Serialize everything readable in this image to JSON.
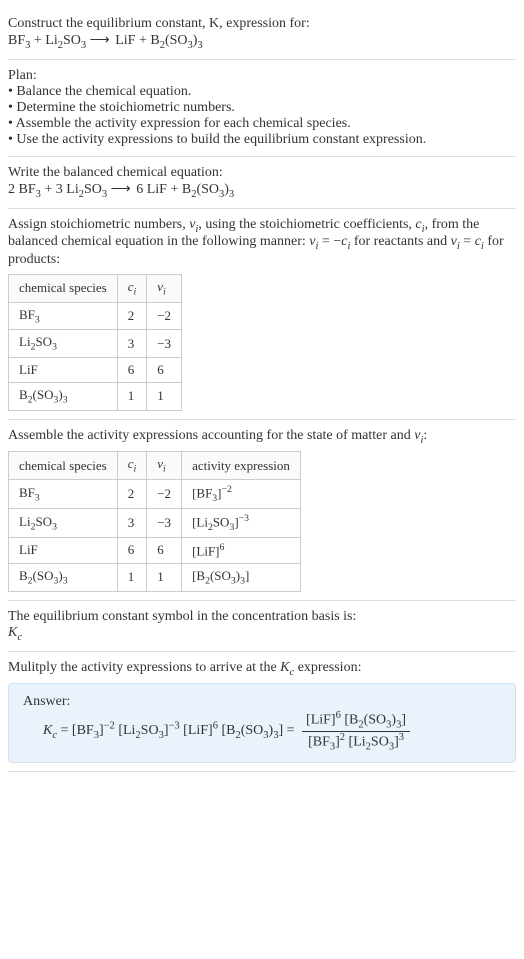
{
  "intro": {
    "line1": "Construct the equilibrium constant, K, expression for:",
    "eq1_lhs1": "BF",
    "eq1_lhs1_sub": "3",
    "eq1_plus1": " + ",
    "eq1_lhs2": "Li",
    "eq1_lhs2_sub": "2",
    "eq1_lhs2b": "SO",
    "eq1_lhs2b_sub": "3",
    "arrow": " ⟶ ",
    "eq1_rhs1": "LiF + B",
    "eq1_rhs1_sub": "2",
    "eq1_rhs1b": "(SO",
    "eq1_rhs1b_sub": "3",
    "eq1_rhs1c": ")",
    "eq1_rhs1c_sub": "3"
  },
  "plan": {
    "heading": "Plan:",
    "b1": "• Balance the chemical equation.",
    "b2": "• Determine the stoichiometric numbers.",
    "b3": "• Assemble the activity expression for each chemical species.",
    "b4": "• Use the activity expressions to build the equilibrium constant expression."
  },
  "balanced": {
    "heading": "Write the balanced chemical equation:",
    "lhs1_coef": "2 ",
    "lhs1": "BF",
    "lhs1_sub": "3",
    "plus1": " + ",
    "lhs2_coef": "3 ",
    "lhs2": "Li",
    "lhs2_sub": "2",
    "lhs2b": "SO",
    "lhs2b_sub": "3",
    "arrow": " ⟶ ",
    "rhs1_coef": "6 ",
    "rhs1": "LiF + B",
    "rhs1_sub": "2",
    "rhs1b": "(SO",
    "rhs1b_sub": "3",
    "rhs1c": ")",
    "rhs1c_sub": "3"
  },
  "stoich": {
    "para_a": "Assign stoichiometric numbers, ",
    "nu": "ν",
    "nu_sub": "i",
    "para_b": ", using the stoichiometric coefficients, ",
    "c": "c",
    "c_sub": "i",
    "para_c": ", from the balanced chemical equation in the following manner: ",
    "rel1a": "ν",
    "rel1a_sub": "i",
    "rel1b": " = −",
    "rel1c": "c",
    "rel1c_sub": "i",
    "para_d": " for reactants and ",
    "rel2a": "ν",
    "rel2a_sub": "i",
    "rel2b": " = ",
    "rel2c": "c",
    "rel2c_sub": "i",
    "para_e": " for products:",
    "hdr_species": "chemical species",
    "hdr_ci": "c",
    "hdr_ci_sub": "i",
    "hdr_vi": "ν",
    "hdr_vi_sub": "i",
    "rows": [
      {
        "s_a": "BF",
        "s_sub": "3",
        "s_b": "",
        "s_b_sub": "",
        "s_c": "",
        "s_c_sub": "",
        "ci": "2",
        "vi": "−2"
      },
      {
        "s_a": "Li",
        "s_sub": "2",
        "s_b": "SO",
        "s_b_sub": "3",
        "s_c": "",
        "s_c_sub": "",
        "ci": "3",
        "vi": "−3"
      },
      {
        "s_a": "LiF",
        "s_sub": "",
        "s_b": "",
        "s_b_sub": "",
        "s_c": "",
        "s_c_sub": "",
        "ci": "6",
        "vi": "6"
      },
      {
        "s_a": "B",
        "s_sub": "2",
        "s_b": "(SO",
        "s_b_sub": "3",
        "s_c": ")",
        "s_c_sub": "3",
        "ci": "1",
        "vi": "1"
      }
    ]
  },
  "activity": {
    "heading_a": "Assemble the activity expressions accounting for the state of matter and ",
    "nu": "ν",
    "nu_sub": "i",
    "colon": ":",
    "hdr_species": "chemical species",
    "hdr_ci": "c",
    "hdr_ci_sub": "i",
    "hdr_vi": "ν",
    "hdr_vi_sub": "i",
    "hdr_act": "activity expression",
    "rows": [
      {
        "s_a": "BF",
        "s_sub": "3",
        "s_b": "",
        "s_b_sub": "",
        "s_c": "",
        "s_c_sub": "",
        "ci": "2",
        "vi": "−2",
        "ae_a": "[BF",
        "ae_a_sub": "3",
        "ae_b": "]",
        "ae_sup": "−2",
        "ae_c": "",
        "ae_c_sub": "",
        "ae_d": "",
        "ae_d_sub": ""
      },
      {
        "s_a": "Li",
        "s_sub": "2",
        "s_b": "SO",
        "s_b_sub": "3",
        "s_c": "",
        "s_c_sub": "",
        "ci": "3",
        "vi": "−3",
        "ae_a": "[Li",
        "ae_a_sub": "2",
        "ae_b": "SO",
        "ae_sup": "",
        "ae_c": "",
        "ae_c_sub": "3",
        "ae_d": "]",
        "ae_d_sub": "",
        "ae_d_sup": "−3"
      },
      {
        "s_a": "LiF",
        "s_sub": "",
        "s_b": "",
        "s_b_sub": "",
        "s_c": "",
        "s_c_sub": "",
        "ci": "6",
        "vi": "6",
        "ae_a": "[LiF]",
        "ae_a_sub": "",
        "ae_b": "",
        "ae_sup": "6",
        "ae_c": "",
        "ae_c_sub": "",
        "ae_d": "",
        "ae_d_sub": ""
      },
      {
        "s_a": "B",
        "s_sub": "2",
        "s_b": "(SO",
        "s_b_sub": "3",
        "s_c": ")",
        "s_c_sub": "3",
        "ci": "1",
        "vi": "1",
        "ae_a": "[B",
        "ae_a_sub": "2",
        "ae_b": "(SO",
        "ae_sup": "",
        "ae_c": "",
        "ae_c_sub": "3",
        "ae_d": ")",
        "ae_d_sub": "3",
        "ae_e": "]"
      }
    ]
  },
  "kc_symbol": {
    "heading": "The equilibrium constant symbol in the concentration basis is:",
    "k": "K",
    "k_sub": "c"
  },
  "final": {
    "heading_a": "Mulitply the activity expressions to arrive at the ",
    "k": "K",
    "k_sub": "c",
    "heading_b": " expression:",
    "answer_label": "Answer:",
    "lhs_k": "K",
    "lhs_k_sub": "c",
    "eq": " = ",
    "t1": "[BF",
    "t1_sub": "3",
    "t1b": "]",
    "t1_sup": "−2",
    "t2": " [Li",
    "t2_sub": "2",
    "t2b": "SO",
    "t2b_sub": "3",
    "t2c": "]",
    "t2_sup": "−3",
    "t3": " [LiF]",
    "t3_sup": "6",
    "t4": " [B",
    "t4_sub": "2",
    "t4b": "(SO",
    "t4b_sub": "3",
    "t4c": ")",
    "t4c_sub": "3",
    "t4d": "]",
    "eq2": " = ",
    "num_a": "[LiF]",
    "num_a_sup": "6",
    "num_b": " [B",
    "num_b_sub": "2",
    "num_c": "(SO",
    "num_c_sub": "3",
    "num_d": ")",
    "num_d_sub": "3",
    "num_e": "]",
    "den_a": "[BF",
    "den_a_sub": "3",
    "den_b": "]",
    "den_b_sup": "2",
    "den_c": " [Li",
    "den_c_sub": "2",
    "den_d": "SO",
    "den_d_sub": "3",
    "den_e": "]",
    "den_e_sup": "3"
  },
  "chart_data": {
    "type": "table",
    "tables": [
      {
        "title": "Stoichiometric numbers",
        "columns": [
          "chemical species",
          "c_i",
          "ν_i"
        ],
        "rows": [
          [
            "BF3",
            2,
            -2
          ],
          [
            "Li2SO3",
            3,
            -3
          ],
          [
            "LiF",
            6,
            6
          ],
          [
            "B2(SO3)3",
            1,
            1
          ]
        ]
      },
      {
        "title": "Activity expressions",
        "columns": [
          "chemical species",
          "c_i",
          "ν_i",
          "activity expression"
        ],
        "rows": [
          [
            "BF3",
            2,
            -2,
            "[BF3]^-2"
          ],
          [
            "Li2SO3",
            3,
            -3,
            "[Li2SO3]^-3"
          ],
          [
            "LiF",
            6,
            6,
            "[LiF]^6"
          ],
          [
            "B2(SO3)3",
            1,
            1,
            "[B2(SO3)3]"
          ]
        ]
      }
    ]
  }
}
